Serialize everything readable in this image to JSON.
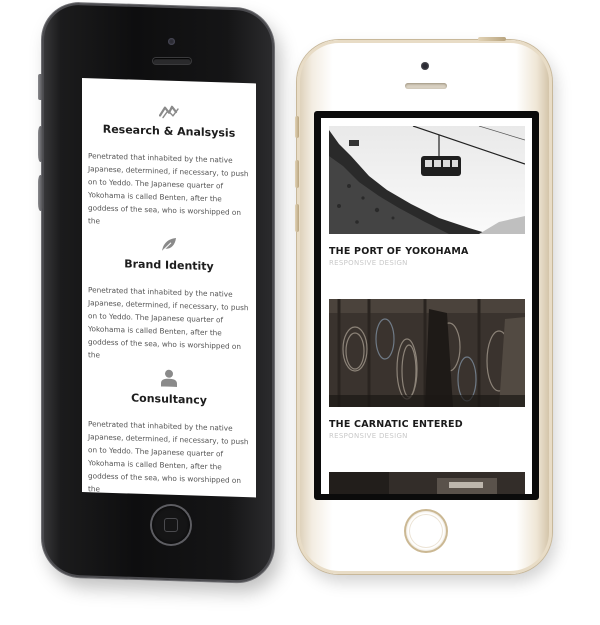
{
  "left_phone": {
    "services": [
      {
        "icon": "chart-line-icon",
        "title": "Research & Analsysis",
        "text": "Penetrated that inhabited by the native Japanese, determined, if necessary, to push on to Yeddo. The Japanese quarter of Yokohama is called Benten, after the goddess of the sea, who is worshipped on the"
      },
      {
        "icon": "leaf-icon",
        "title": "Brand Identity",
        "text": "Penetrated that inhabited by the native Japanese, determined, if necessary, to push on to Yeddo. The Japanese quarter of Yokohama is called Benten, after the goddess of the sea, who is worshipped on the"
      },
      {
        "icon": "person-icon",
        "title": "Consultancy",
        "text": "Penetrated that inhabited by the native Japanese, determined, if necessary, to push on to Yeddo. The Japanese quarter of Yokohama is called Benten, after the goddess of the sea, who is worshipped on the"
      }
    ]
  },
  "right_phone": {
    "portfolio": [
      {
        "title": "THE PORT OF YOKOHAMA",
        "category": "RESPONSIVE DESIGN",
        "image": "cable-car-photo"
      },
      {
        "title": "THE CARNATIC ENTERED",
        "category": "RESPONSIVE DESIGN",
        "image": "hanging-ropes-photo"
      }
    ]
  },
  "colors": {
    "icon_gray": "#8a8a8a",
    "title_dark": "#1d1d1d",
    "subtitle_light": "#c9c9c9",
    "space_gray": "#1b1b1c",
    "gold_frame": "#e8dcc6"
  }
}
